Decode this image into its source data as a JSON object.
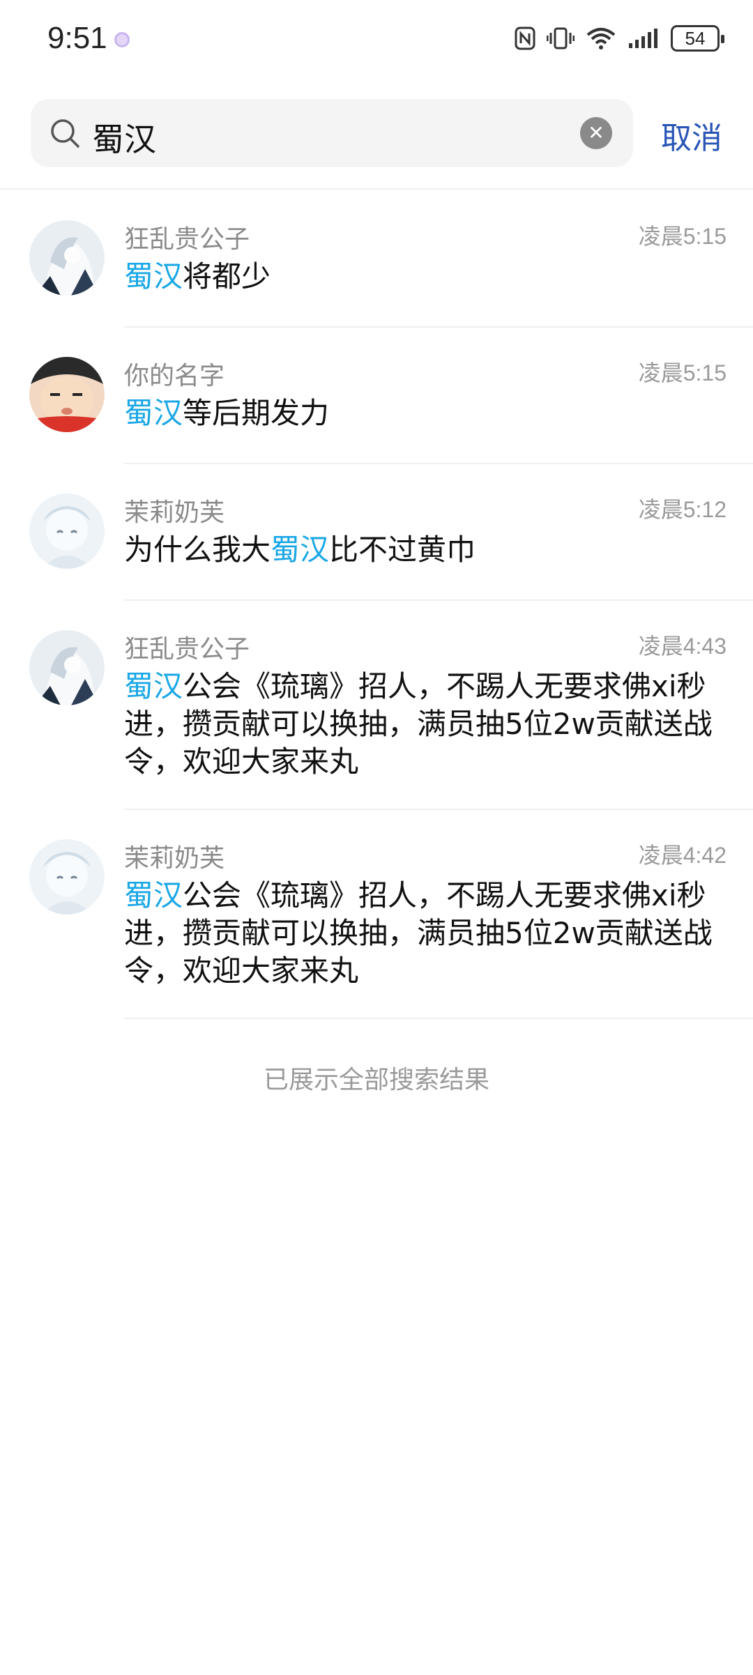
{
  "status_bar": {
    "time": "9:51",
    "battery": "54",
    "icons": [
      "nfc-icon",
      "vibrate-icon",
      "wifi-icon",
      "signal-icon",
      "battery-icon"
    ]
  },
  "search": {
    "value": "蜀汉",
    "cancel_label": "取消"
  },
  "results": [
    {
      "name": "狂乱贵公子",
      "time": "凌晨5:15",
      "pre": "",
      "highlight": "蜀汉",
      "post": "将都少",
      "avatar": "anime-avatar"
    },
    {
      "name": "你的名字",
      "time": "凌晨5:15",
      "pre": "",
      "highlight": "蜀汉",
      "post": "等后期发力",
      "avatar": "cartoon-avatar"
    },
    {
      "name": "茉莉奶芙",
      "time": "凌晨5:12",
      "pre": "为什么我大",
      "highlight": "蜀汉",
      "post": "比不过黄巾",
      "avatar": "anime-avatar"
    },
    {
      "name": "狂乱贵公子",
      "time": "凌晨4:43",
      "pre": "",
      "highlight": "蜀汉",
      "post": "公会《琉璃》招人，不踢人无要求佛xi秒进，攒贡献可以换抽，满员抽5位2w贡献送战令，欢迎大家来丸",
      "avatar": "anime-avatar"
    },
    {
      "name": "茉莉奶芙",
      "time": "凌晨4:42",
      "pre": "",
      "highlight": "蜀汉",
      "post": "公会《琉璃》招人，不踢人无要求佛xi秒进，攒贡献可以换抽，满员抽5位2w贡献送战令，欢迎大家来丸",
      "avatar": "anime-avatar"
    }
  ],
  "footer_text": "已展示全部搜索结果",
  "colors": {
    "highlight": "#1aa7e6",
    "cancel": "#2a56b8",
    "secondary_text": "#8a8a8a"
  }
}
